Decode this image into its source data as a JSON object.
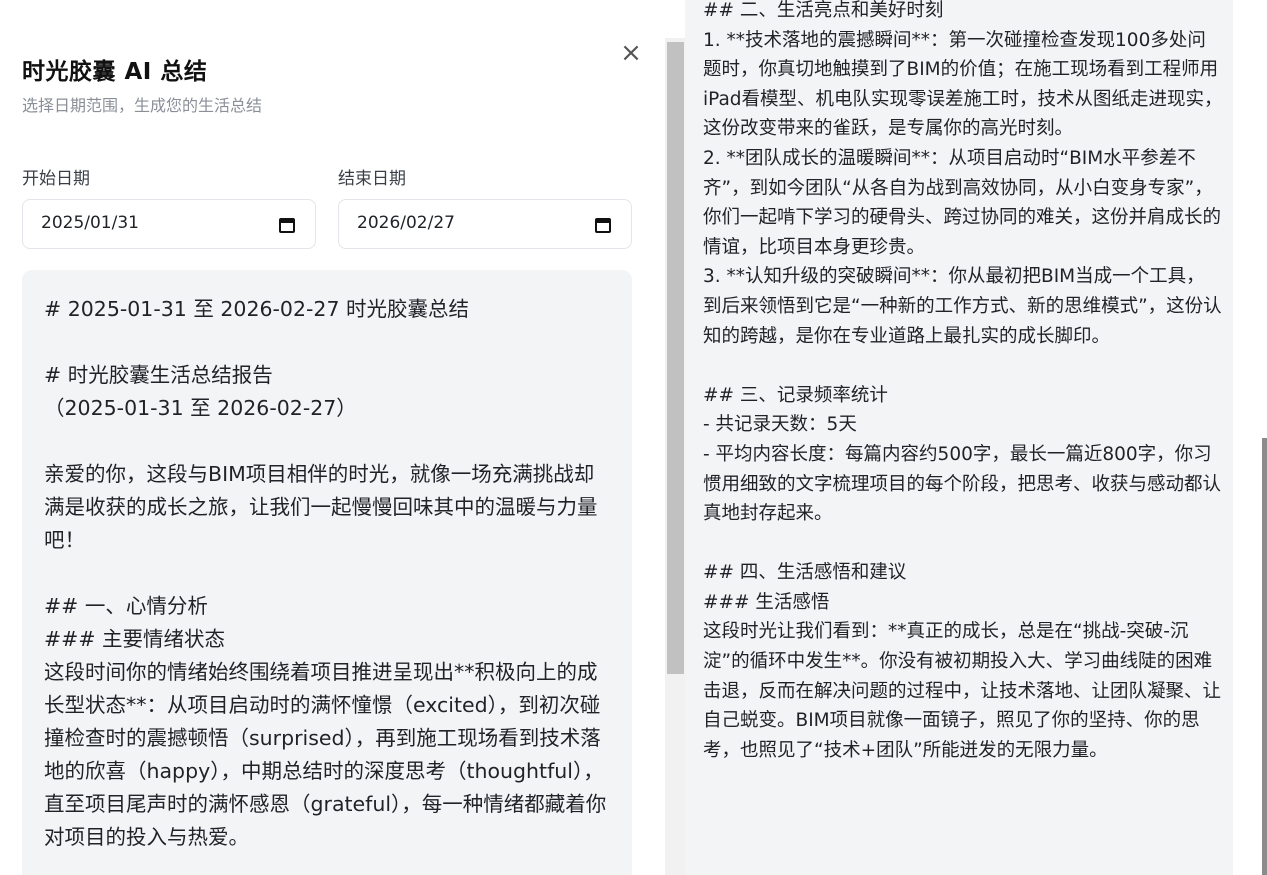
{
  "dialog": {
    "title": "时光胶囊 AI 总结",
    "subtitle": "选择日期范围，生成您的生活总结",
    "close_glyph": "×"
  },
  "date_range": {
    "start_label": "开始日期",
    "start_value": "2025/01/31",
    "end_label": "结束日期",
    "end_value": "2026/02/27"
  },
  "summary_left": {
    "text": "# 2025-01-31 至 2026-02-27 时光胶囊总结\n\n# 时光胶囊生活总结报告\n（2025-01-31 至 2026-02-27）\n\n亲爱的你，这段与BIM项目相伴的时光，就像一场充满挑战却满是收获的成长之旅，让我们一起慢慢回味其中的温暖与力量吧！\n\n## 一、心情分析\n### 主要情绪状态\n这段时间你的情绪始终围绕着项目推进呈现出**积极向上的成长型状态**：从项目启动时的满怀憧憬（excited），到初次碰撞检查时的震撼顿悟（surprised），再到施工现场看到技术落地的欣喜（happy），中期总结时的深度思考（thoughtful），直至项目尾声时的满怀感恩（grateful），每一种情绪都藏着你对项目的投入与热爱。"
  },
  "summary_right": {
    "text": "## 二、生活亮点和美好时刻\n1. **技术落地的震撼瞬间**：第一次碰撞检查发现100多处问题时，你真切地触摸到了BIM的价值；在施工现场看到工程师用iPad看模型、机电队实现零误差施工时，技术从图纸走进现实，这份改变带来的雀跃，是专属你的高光时刻。\n2. **团队成长的温暖瞬间**：从项目启动时“BIM水平参差不齐”，到如今团队“从各自为战到高效协同，从小白变身专家”，你们一起啃下学习的硬骨头、跨过协同的难关，这份并肩成长的情谊，比项目本身更珍贵。\n3. **认知升级的突破瞬间**：你从最初把BIM当成一个工具，到后来领悟到它是“一种新的工作方式、新的思维模式”，这份认知的跨越，是你在专业道路上最扎实的成长脚印。\n\n## 三、记录频率统计\n- 共记录天数：5天\n- 平均内容长度：每篇内容约500字，最长一篇近800字，你习惯用细致的文字梳理项目的每个阶段，把思考、收获与感动都认真地封存起来。\n\n## 四、生活感悟和建议\n### 生活感悟\n这段时光让我们看到：**真正的成长，总是在“挑战-突破-沉淀”的循环中发生**。你没有被初期投入大、学习曲线陡的困难击退，反而在解决问题的过程中，让技术落地、让团队凝聚、让自己蜕变。BIM项目就像一面镜子，照见了你的坚持、你的思考，也照见了“技术+团队”所能迸发的无限力量。"
  }
}
